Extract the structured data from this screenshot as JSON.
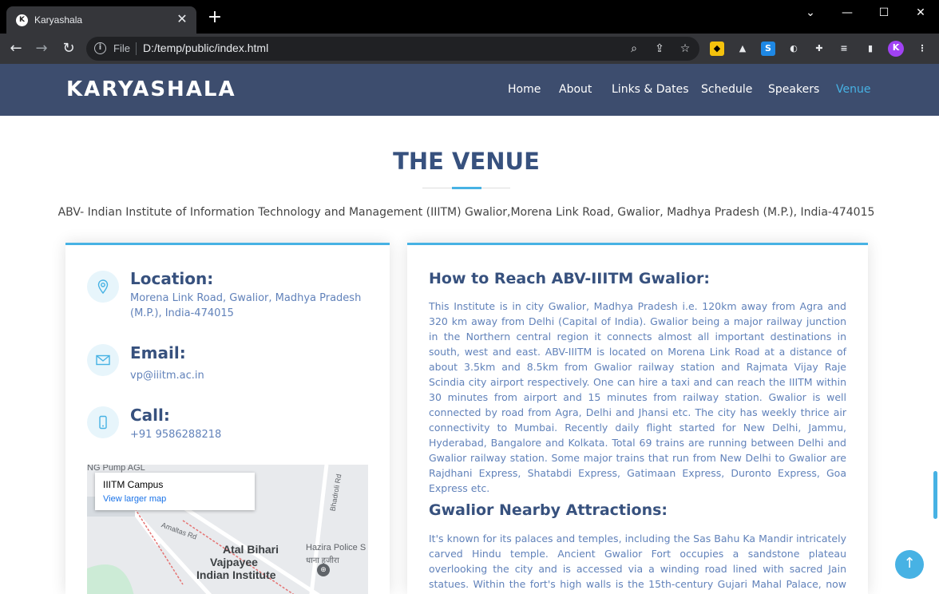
{
  "browser": {
    "tab_title": "Karyashala",
    "scheme_label": "File",
    "url": "D:/temp/public/index.html",
    "new_tab_symbol": "+",
    "close_symbol": "✕"
  },
  "site": {
    "logo": "KARYASHALA",
    "nav": [
      {
        "label": "Home"
      },
      {
        "label": "About"
      },
      {
        "label": "Links & Dates"
      },
      {
        "label": "Schedule"
      },
      {
        "label": "Speakers"
      },
      {
        "label": "Venue",
        "active": true
      }
    ]
  },
  "venue": {
    "title": "THE VENUE",
    "address": "ABV- Indian Institute of Information Technology and Management (IIITM) Gwalior,Morena Link Road, Gwalior, Madhya Pradesh (M.P.), India-474015",
    "location": {
      "heading": "Location:",
      "text": "Morena Link Road, Gwalior, Madhya Pradesh (M.P.), India-474015"
    },
    "email": {
      "heading": "Email:",
      "text": "vp@iiitm.ac.in"
    },
    "call": {
      "heading": "Call:",
      "text": "+91 9586288218"
    },
    "map": {
      "place_name": "IIITM Campus",
      "link_text": "View larger map",
      "labels": [
        "NG Pump AGL",
        "Atal Bihari",
        "Vajpayee",
        "Indian Institute",
        "Hazira Police S",
        "धाना हजीरा",
        "Bhadroli Rd",
        "Amaltas Rd"
      ]
    },
    "reach": {
      "heading": "How to Reach ABV-IIITM Gwalior:",
      "text": "This Institute is in city Gwalior, Madhya Pradesh i.e. 120km away from Agra and 320 km away from Delhi (Capital of India). Gwalior being a major railway junction in the Northern central region it connects almost all important destinations in south, west and east. ABV-IIITM is located on Morena Link Road at a distance of about 3.5km and 8.5km from Gwalior railway station and Rajmata Vijay Raje Scindia city airport respectively. One can hire a taxi and can reach the IIITM within 30 minutes from airport and 15 minutes from railway station. Gwalior is well connected by road from Agra, Delhi and Jhansi etc. The city has weekly thrice air connectivity to Mumbai. Recently daily flight started for New Delhi, Jammu, Hyderabad, Bangalore and Kolkata. Total 69 trains are running between Delhi and Gwalior railway station. Some major trains that run from New Delhi to Gwalior are Rajdhani Express, Shatabdi Express, Gatimaan Express, Duronto Express, Goa Express etc."
    },
    "attractions": {
      "heading": "Gwalior Nearby Attractions:",
      "text": "It's known for its palaces and temples, including the Sas Bahu Ka Mandir intricately carved Hindu temple. Ancient Gwalior Fort occupies a sandstone plateau overlooking the city and is accessed via a winding road lined with sacred Jain statues. Within the fort's high walls is the 15th-century Gujari Mahal Palace, now an archaeological museum."
    }
  },
  "colors": {
    "header_bg": "#3d4d6e",
    "accent": "#47b2e4",
    "heading": "#37517e",
    "body_text": "#6182ba"
  }
}
